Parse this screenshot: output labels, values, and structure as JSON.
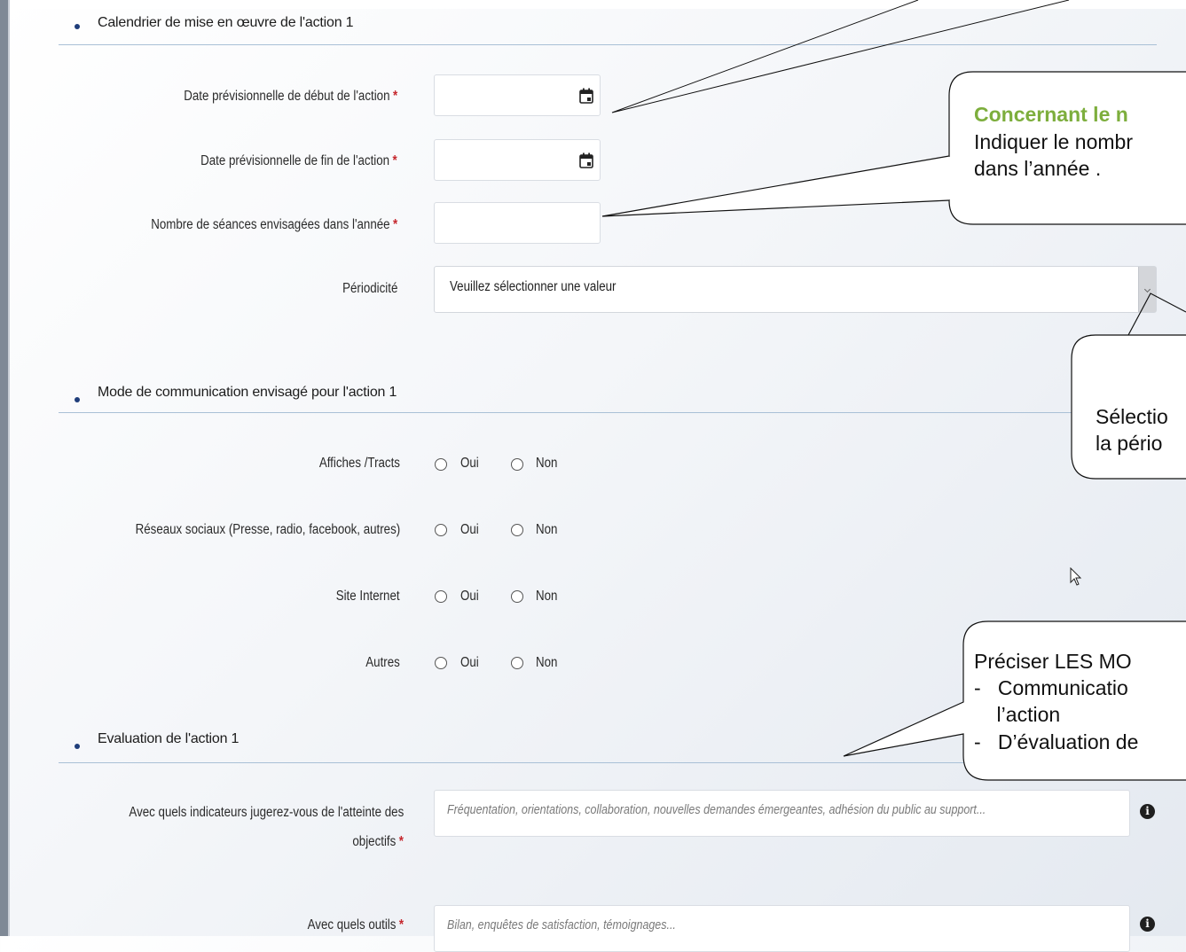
{
  "sections": {
    "calendar_title": "Calendrier de mise en œuvre de l'action 1",
    "communication_title": "Mode de communication envisagé pour l'action 1",
    "evaluation_title": "Evaluation de l'action 1"
  },
  "fields": {
    "start_date_label": "Date prévisionnelle de début de l'action",
    "end_date_label": "Date prévisionnelle de fin de l'action",
    "sessions_label": "Nombre de séances envisagées dans l'année",
    "periodicity_label": "Périodicité",
    "periodicity_value": "Veuillez sélectionner une valeur",
    "required_mark": "*"
  },
  "communication": {
    "rows": [
      {
        "label": "Affiches /Tracts"
      },
      {
        "label": "Réseaux sociaux (Presse, radio, facebook, autres)"
      },
      {
        "label": "Site Internet"
      },
      {
        "label": "Autres"
      }
    ],
    "yes": "Oui",
    "no": "Non"
  },
  "evaluation": {
    "indicators_label_line1": "Avec quels indicateurs jugerez-vous de l'atteinte des",
    "indicators_label_line2": "objectifs",
    "indicators_placeholder": "Fréquentation, orientations, collaboration, nouvelles demandes émergeantes, adhésion du public au support...",
    "tools_label": "Avec quels outils",
    "tools_placeholder": "Bilan, enquêtes de satisfaction, témoignages...",
    "info_glyph": "i"
  },
  "callouts": {
    "sessions_line1": "Concernant le n",
    "sessions_line2": "Indiquer le nombr",
    "sessions_line3": "dans l’année .",
    "periodicity_line1": "Sélectio",
    "periodicity_line2": "la pério",
    "modes_line1": "Préciser LES MO",
    "modes_line2": "-   Communicatio",
    "modes_line3": "    l’action",
    "modes_line4": "-   D’évaluation de"
  },
  "colors": {
    "required": "#c6282e",
    "callout_heading": "#7dae3d",
    "section_line": "#a9c0d6"
  }
}
